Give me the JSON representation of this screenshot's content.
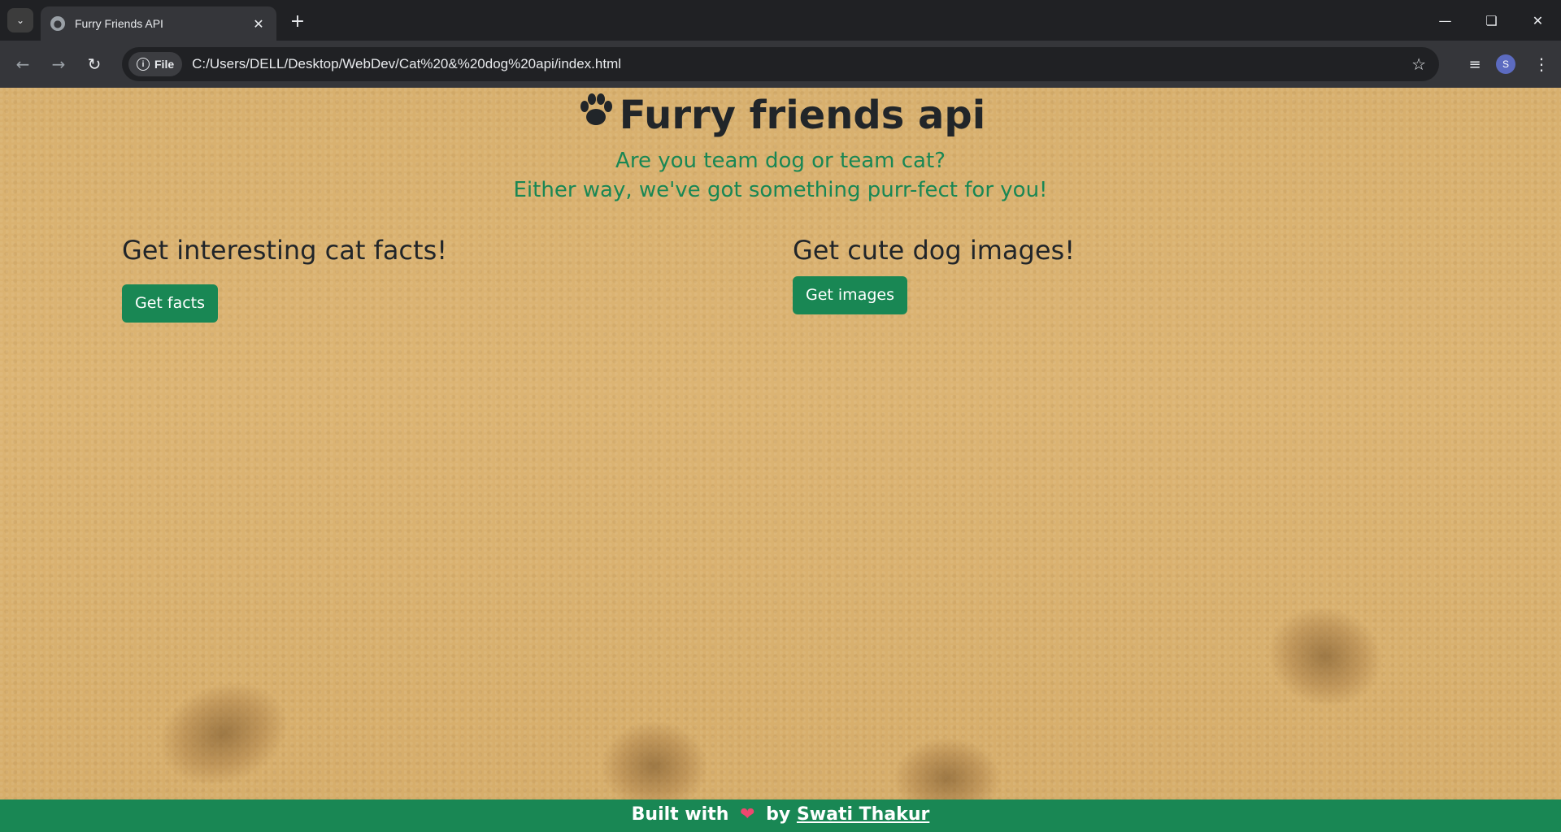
{
  "browser": {
    "tab_title": "Furry Friends API",
    "new_tab_symbol": "+",
    "close_symbol": "✕",
    "file_chip": "File",
    "url": "C:/Users/DELL/Desktop/WebDev/Cat%20&%20dog%20api/index.html",
    "avatar_letter": "S",
    "icons": [
      "tab-search-icon",
      "globe-icon",
      "back-icon",
      "forward-icon",
      "reload-icon",
      "info-icon",
      "star-icon",
      "media-icon",
      "menu-icon",
      "minimize-icon",
      "maximize-icon",
      "close-icon"
    ]
  },
  "page": {
    "title": "Furry friends api",
    "subtitle_line1": "Are you team dog or team cat?",
    "subtitle_line2": "Either way, we've got something purr-fect for you!",
    "cat_section": {
      "heading": "Get interesting cat facts!",
      "button_label": "Get facts"
    },
    "dog_section": {
      "heading": "Get cute dog images!",
      "button_label": "Get images"
    },
    "footer": {
      "prefix": "Built with",
      "by": "by",
      "author": "Swati Thakur"
    }
  },
  "colors": {
    "accent": "#198754",
    "heading_text": "#212529",
    "sand": "#d8b06e",
    "heart": "#ef476f"
  }
}
